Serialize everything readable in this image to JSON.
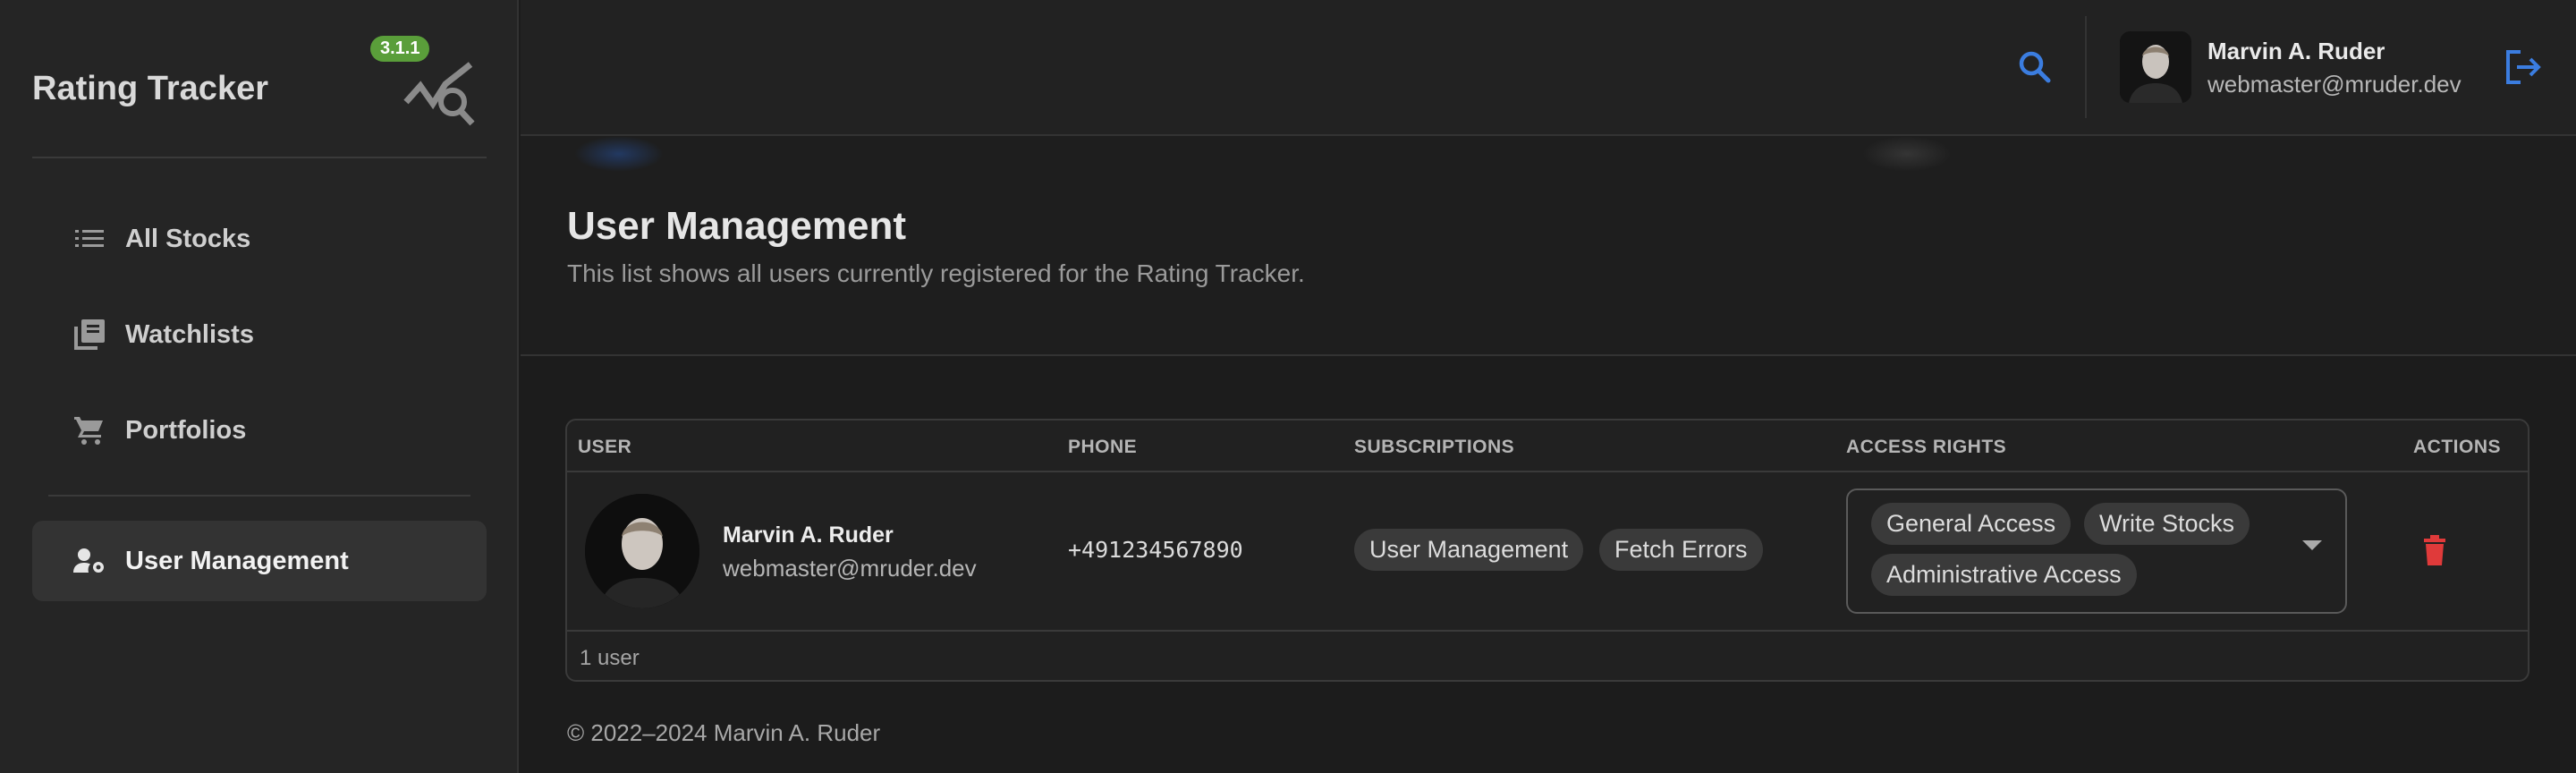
{
  "app": {
    "title": "Rating Tracker",
    "version": "3.1.1"
  },
  "sidebar": {
    "items": [
      {
        "label": "All Stocks",
        "icon": "list-icon"
      },
      {
        "label": "Watchlists",
        "icon": "library-icon"
      },
      {
        "label": "Portfolios",
        "icon": "cart-icon"
      },
      {
        "label": "User Management",
        "icon": "user-settings-icon",
        "active": true
      }
    ]
  },
  "topbar": {
    "user_name": "Marvin A. Ruder",
    "user_email": "webmaster@mruder.dev",
    "accent": "#3b7de0"
  },
  "header": {
    "title": "User Management",
    "subtitle": "This list shows all users currently registered for the Rating Tracker."
  },
  "table": {
    "columns": [
      "USER",
      "PHONE",
      "SUBSCRIPTIONS",
      "ACCESS RIGHTS",
      "ACTIONS"
    ],
    "rows": [
      {
        "name": "Marvin A. Ruder",
        "email": "webmaster@mruder.dev",
        "phone": "+491234567890",
        "subscriptions": [
          "User Management",
          "Fetch Errors"
        ],
        "access_rights": [
          "General Access",
          "Write Stocks",
          "Administrative Access"
        ]
      }
    ],
    "footer": "1 user"
  },
  "footer": {
    "copyright": "© 2022–2024 Marvin A. Ruder"
  },
  "colors": {
    "version_badge": "#5a9e3a",
    "delete": "#e03a3a"
  }
}
